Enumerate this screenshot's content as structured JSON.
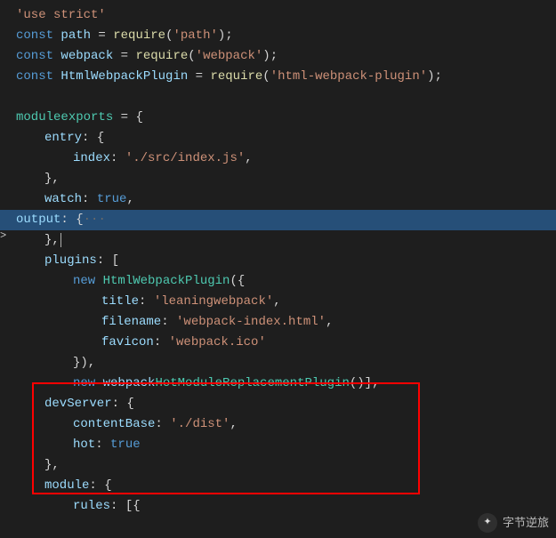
{
  "editor": {
    "l1": "'use strict'",
    "const": "const",
    "new": "new",
    "true": "true",
    "path": "path",
    "eq": " = ",
    "require": "require",
    "pathArg": "'path'",
    "webpack": "webpack",
    "webpackArg": "'webpack'",
    "HtmlWebpackPlugin": "HtmlWebpackPlugin",
    "htmlArg": "'html-webpack-plugin'",
    "module": "module",
    "exports": "exports",
    "open": " = {",
    "entry": "entry",
    "colonOpen": ": {",
    "close": "},",
    "index": "index",
    "indexVal": "'./src/index.js'",
    "watch": "watch",
    "colon": ": ",
    "comma": ",",
    "output": "output",
    "dots": "···",
    "plugins": "plugins",
    "sqOpen": ": [",
    "openParen": "({",
    "closeParenC": "}),",
    "title": "title",
    "titleVal": "'leaningwebpack'",
    "filename": "filename",
    "filenameVal": "'webpack-index.html'",
    "favicon": "favicon",
    "faviconVal": "'webpack.ico'",
    "hmr": "HotModuleReplacementPlugin",
    "hmrEnd": "()],",
    "devServer": "devServer",
    "contentBase": "contentBase",
    "contentBaseVal": "'./dist'",
    "hot": "hot",
    "moduleKey": "module",
    "rules": "rules",
    "rulesOpen": ": [{",
    "semi": ";",
    ")": ")",
    ".": ".",
    "(": "("
  },
  "watermark": {
    "label": "字节逆旅"
  }
}
